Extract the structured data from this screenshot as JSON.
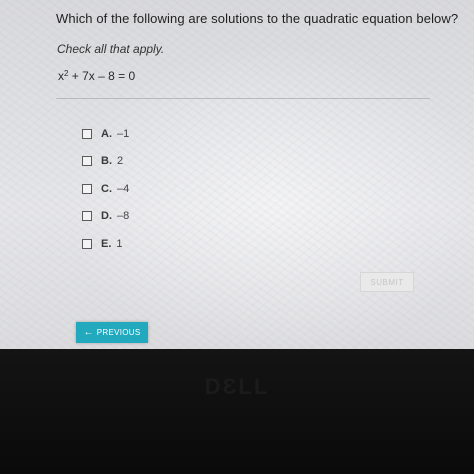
{
  "question": {
    "text": "Which of the following are solutions to the quadratic equation below?",
    "instruction": "Check all that apply.",
    "equation": {
      "var": "x",
      "exponent": "2",
      "rest": " + 7x – 8 = 0"
    }
  },
  "options": [
    {
      "letter": "A.",
      "value": "–1",
      "checked": false
    },
    {
      "letter": "B.",
      "value": "2",
      "checked": false
    },
    {
      "letter": "C.",
      "value": "–4",
      "checked": false
    },
    {
      "letter": "D.",
      "value": "–8",
      "checked": false
    },
    {
      "letter": "E.",
      "value": "1",
      "checked": false
    }
  ],
  "buttons": {
    "submit": "SUBMIT",
    "previous": "PREVIOUS",
    "previous_icon": "arrow-left-icon"
  },
  "monitor": {
    "logo": "DƐLL"
  },
  "colors": {
    "accent": "#23a9be",
    "submit_disabled": "#e9e9ea"
  }
}
